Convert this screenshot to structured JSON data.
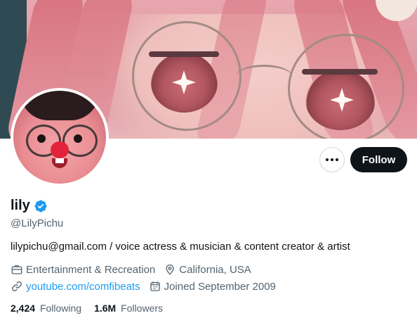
{
  "profile": {
    "display_name": "lily",
    "verified_icon": "verified-badge-icon",
    "handle": "@LilyPichu",
    "bio": "lilypichu@gmail.com / voice actress & musician & content creator & artist",
    "category": "Entertainment & Recreation",
    "location": "California, USA",
    "website": "youtube.com/comfibeats",
    "joined": "Joined September 2009"
  },
  "actions": {
    "more_icon": "more-options-icon",
    "follow_label": "Follow"
  },
  "stats": {
    "following_count": "2,424",
    "following_label": "Following",
    "followers_count": "1.6M",
    "followers_label": "Followers"
  },
  "colors": {
    "accent": "#1d9bf0",
    "follow_button_bg": "#0f1419",
    "secondary_text": "#536471"
  }
}
